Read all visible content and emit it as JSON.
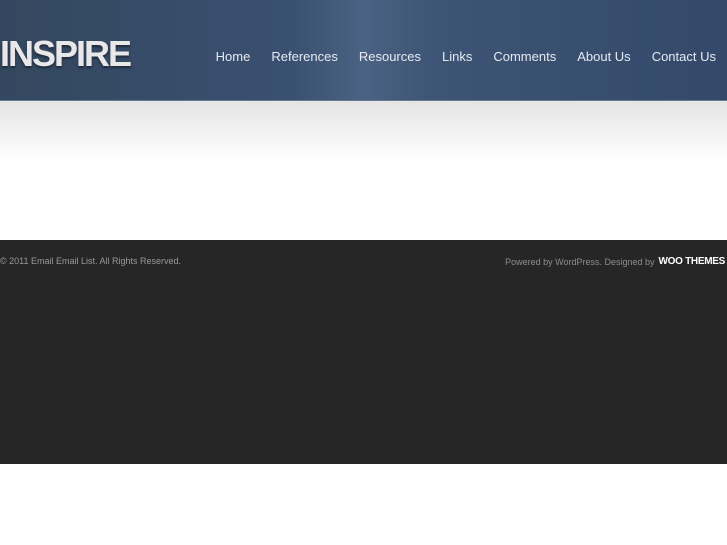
{
  "header": {
    "logo": "INSPIRE",
    "nav": [
      "Home",
      "References",
      "Resources",
      "Links",
      "Comments",
      "About Us",
      "Contact Us"
    ]
  },
  "footer": {
    "copyright": "© 2011 Email Email List. All Rights Reserved.",
    "credit": "Powered by WordPress. Designed by",
    "woo_logo": "WOO THEMES"
  }
}
